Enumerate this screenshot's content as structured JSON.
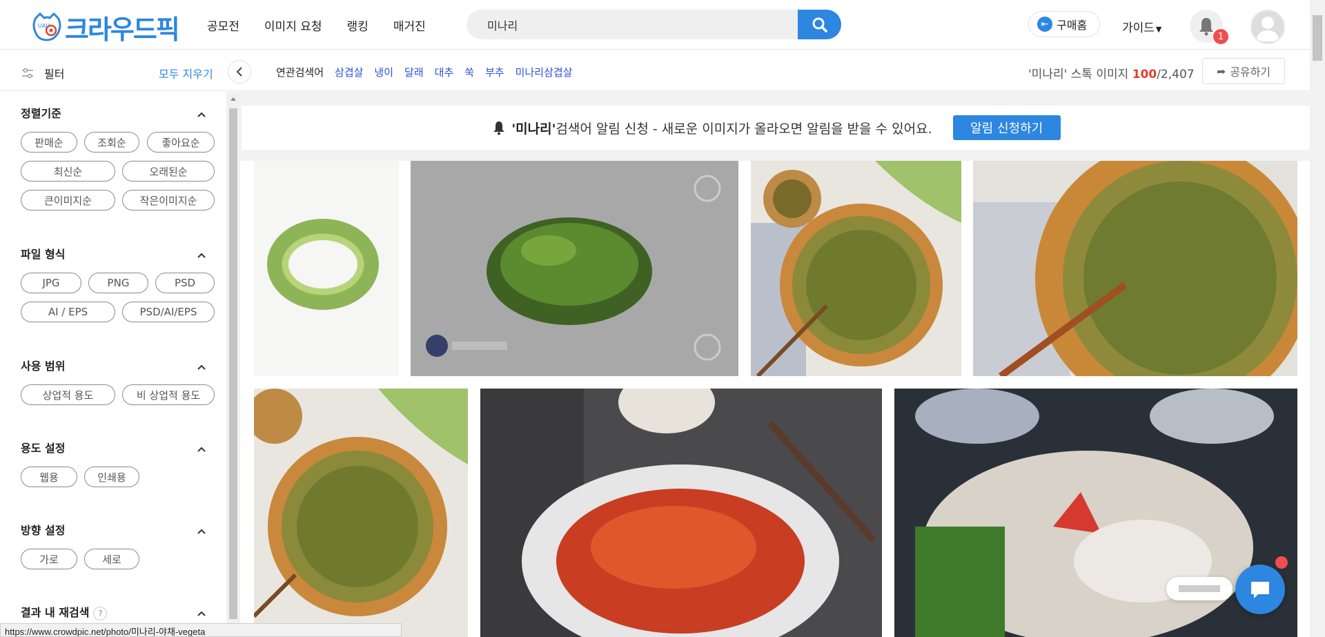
{
  "header": {
    "logo_text": "크라우드픽",
    "nav": [
      "공모전",
      "이미지 요청",
      "랭킹",
      "매거진"
    ],
    "search_value": "미나리",
    "buy_home": "구매홈",
    "guide": "가이드",
    "notification_count": "1"
  },
  "subbar": {
    "filter_label": "필터",
    "clear_all": "모두 지우기",
    "related_label": "연관검색어",
    "related_keywords": [
      "삼겹살",
      "냉이",
      "달래",
      "대추",
      "쑥",
      "부추",
      "미나리삼겹살"
    ],
    "count_prefix": "'미나리' 스톡 이미지 ",
    "count_shown": "100",
    "count_total": "/2,407",
    "share": "공유하기"
  },
  "sidebar": {
    "sections": [
      {
        "title": "정렬기준",
        "options": [
          "판매순",
          "조회순",
          "좋아요순",
          "최신순",
          "오래된순",
          "큰이미지순",
          "작은이미지순"
        ]
      },
      {
        "title": "파일 형식",
        "options": [
          "JPG",
          "PNG",
          "PSD",
          "AI / EPS",
          "PSD/AI/EPS"
        ]
      },
      {
        "title": "사용 범위",
        "options": [
          "상업적 용도",
          "비 상업적 용도"
        ]
      },
      {
        "title": "용도 설정",
        "options": [
          "웹용",
          "인쇄용"
        ]
      },
      {
        "title": "방향 설정",
        "options": [
          "가로",
          "세로"
        ]
      },
      {
        "title": "결과 내 재검색",
        "options": []
      }
    ],
    "research_help": "?"
  },
  "alert": {
    "keyword": "'미나리'",
    "message": " 검색어 알림 신청 - 새로운 이미지가 올라오면 알림을 받을 수 있어요.",
    "button": "알림 신청하기"
  },
  "status_url": "https://www.crowdpic.net/photo/미나리-야채-vegeta",
  "colors": {
    "accent": "#2d86e0",
    "badge": "#ef4e4e",
    "count_red": "#e0412d"
  }
}
